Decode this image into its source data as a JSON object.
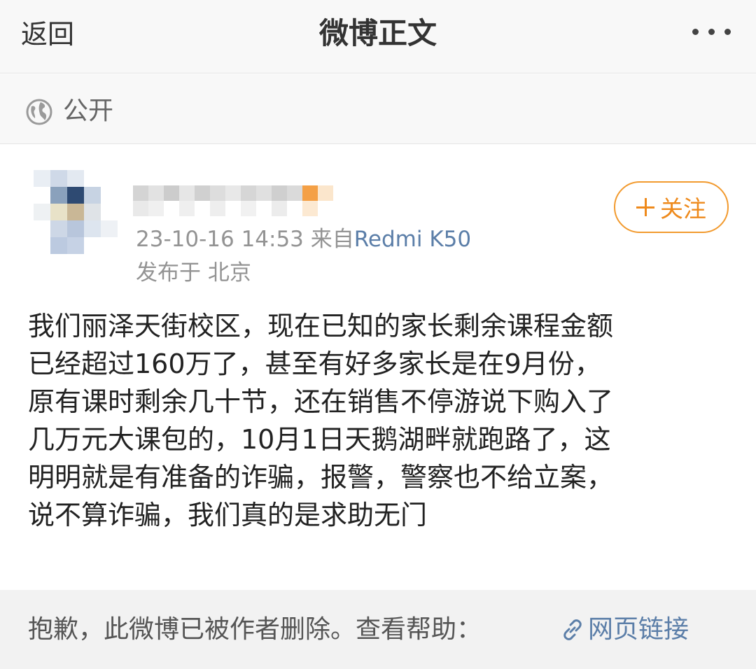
{
  "navbar": {
    "back_label": "返回",
    "title": "微博正文",
    "more_icon": "more-horizontal-icon"
  },
  "visibility": {
    "icon": "globe-icon",
    "label": "公开"
  },
  "post": {
    "author": {
      "avatar": "blurred",
      "name": "blurred"
    },
    "timestamp": "23-10-16 14:53",
    "source_prefix": "来自",
    "device": "Redmi K50",
    "location": "发布于 北京",
    "follow_label": "关注",
    "follow_icon": "plus-icon",
    "body_lines": [
      "我们丽泽天街校区，现在已知的家长剩余课程金额",
      "已经超过160万了，甚至有好多家长是在9月份，",
      "原有课时剩余几十节，还在销售不停游说下购入了",
      "几万元大课包的，10月1日天鹅湖畔就跑路了，这",
      "明明就是有准备的诈骗，报警，警察也不给立案，",
      "说不算诈骗，我们真的是求助无门"
    ]
  },
  "notice": {
    "text": "抱歉，此微博已被作者删除。查看帮助：",
    "link_icon": "link-icon",
    "link_label": "网页链接"
  },
  "colors": {
    "accent_orange": "#ee8a1c",
    "link_blue": "#5b7ea8",
    "meta_gray": "#939393"
  }
}
